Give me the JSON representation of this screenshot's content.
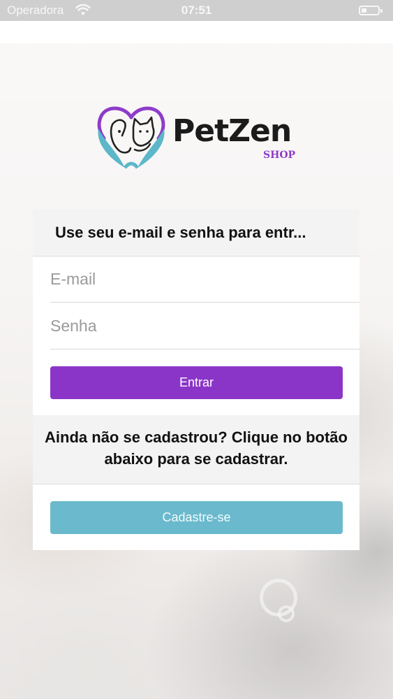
{
  "status_bar": {
    "carrier": "Operadora",
    "time": "07:51",
    "icons": [
      "wifi-icon",
      "battery-icon"
    ],
    "battery_level": 0.3
  },
  "brand": {
    "name": "PetZen",
    "subtitle": "SHOP",
    "logo_icon": "heart-hands-dog-cat-logo"
  },
  "login": {
    "title": "Use seu e-mail e senha para entr...",
    "email_placeholder": "E-mail",
    "password_placeholder": "Senha",
    "submit_label": "Entrar"
  },
  "signup": {
    "prompt": "Ainda não se cadastrou? Clique no botão abaixo para se cadastrar.",
    "button_label": "Cadastre-se"
  },
  "colors": {
    "primary_purple": "#8a35c8",
    "signup_teal": "#6ab9cc",
    "logo_teal": "#5bb7c9"
  }
}
